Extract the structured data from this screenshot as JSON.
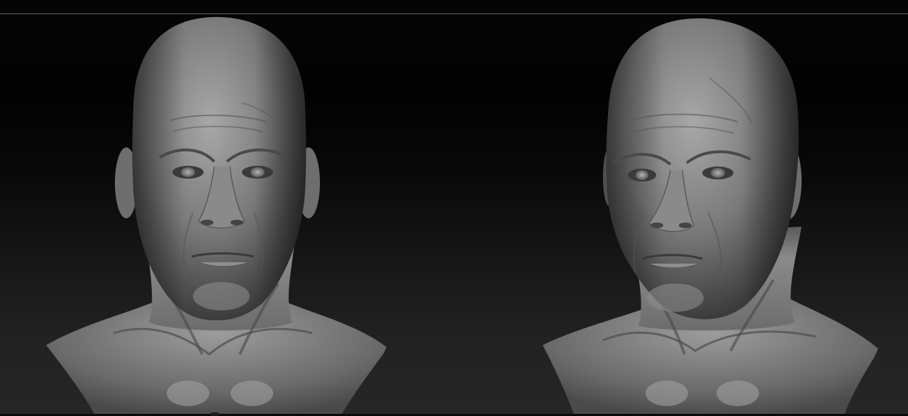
{
  "scene": {
    "background_top": "#020202",
    "background_bottom": "#262626",
    "material_color": "#8c8c8c"
  },
  "views": [
    {
      "name": "front-view",
      "icon": "bust-front"
    },
    {
      "name": "three-quarter-view",
      "icon": "bust-three-quarter"
    }
  ]
}
